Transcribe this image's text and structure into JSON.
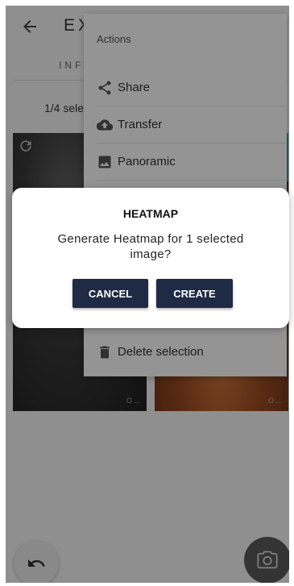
{
  "header": {
    "title": "EX",
    "back_icon": "arrow-back-icon"
  },
  "tabs": [
    {
      "label": "INF"
    }
  ],
  "selection": {
    "count_text": "1/4 sele"
  },
  "thumbnails": [
    {
      "name": "fundus-grayscale",
      "refresh_icon": "refresh-icon",
      "watermark": "O ..."
    },
    {
      "name": "fundus-color",
      "watermark": "O ..."
    }
  ],
  "actions_menu": {
    "header": "Actions",
    "items": [
      {
        "label": "Share",
        "icon": "share-icon"
      },
      {
        "label": "Transfer",
        "icon": "cloud-upload-icon"
      },
      {
        "label": "Panoramic",
        "icon": "image-icon"
      },
      {
        "label": "Delete selection",
        "icon": "trash-icon"
      }
    ]
  },
  "dialog": {
    "title": "HEATMAP",
    "message": "Generate Heatmap for 1 selected image?",
    "cancel_label": "CANCEL",
    "create_label": "CREATE"
  },
  "fab": {
    "undo_icon": "undo-icon",
    "camera_icon": "camera-icon"
  },
  "colors": {
    "dialog_button": "#1f2a44",
    "accent_edge": "#2bb3a0"
  }
}
